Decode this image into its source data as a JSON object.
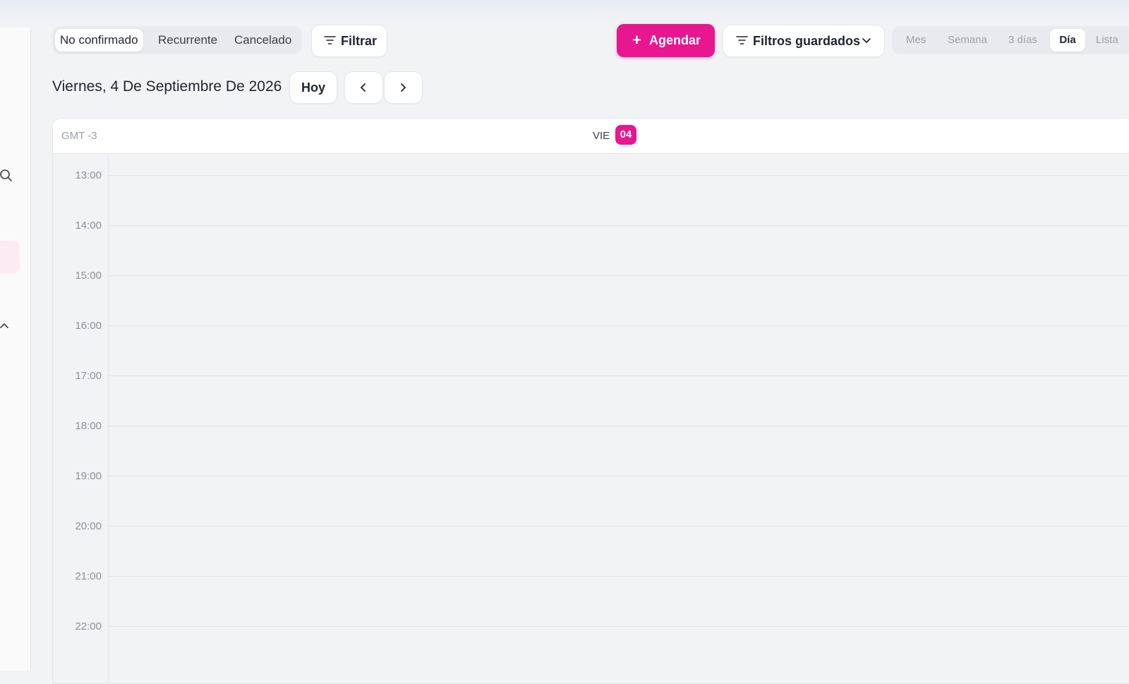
{
  "status_filters": [
    "No confirmado",
    "Recurrente",
    "Cancelado"
  ],
  "filter_button": {
    "label": "Filtrar",
    "icon": "filter-icon"
  },
  "schedule_button": {
    "label": "Agendar",
    "icon": "plus-icon",
    "color": "#e8168f"
  },
  "saved_filters": {
    "label": "Filtros guardados",
    "icon": "filter-icon",
    "chevron": "chevron-down-icon"
  },
  "views": {
    "mes": "Mes",
    "semana": "Semana",
    "tres_dias": "3 días",
    "dia": "Día",
    "lista": "Lista",
    "active": "Día"
  },
  "date_title": "Viernes, 4 De Septiembre De 2026",
  "today_button": "Hoy",
  "calendar": {
    "timezone": "GMT -3",
    "day_label": "VIE",
    "day_number": "04",
    "hours": [
      "13:00",
      "14:00",
      "15:00",
      "16:00",
      "17:00",
      "18:00",
      "19:00",
      "20:00",
      "21:00",
      "22:00"
    ]
  },
  "accent_color": "#e8168f"
}
